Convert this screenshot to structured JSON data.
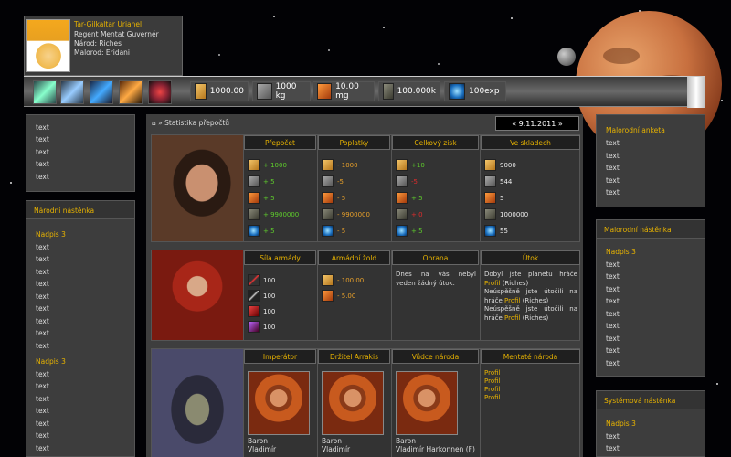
{
  "profile": {
    "name": "Tar-Gilkaltar Urianel",
    "rank": "Regent Mentat Guvernér",
    "nation": "Národ: Riches",
    "race": "Malorod: Eridani"
  },
  "resources": [
    {
      "icon": "gold-icon",
      "value": "1000.00"
    },
    {
      "icon": "metal-icon",
      "value": "1000 kg"
    },
    {
      "icon": "spice-icon",
      "value": "10.00 mg"
    },
    {
      "icon": "rock-icon",
      "value": "100.000k"
    },
    {
      "icon": "exp-icon",
      "value": "100exp"
    }
  ],
  "left": {
    "items_top": [
      "text",
      "text",
      "text",
      "text",
      "text"
    ],
    "section_title": "Národní nástěnka",
    "head1": "Nadpis 3",
    "items_mid": [
      "text",
      "text",
      "text",
      "text",
      "text",
      "text",
      "text",
      "text",
      "text",
      "text"
    ],
    "head2": "Nadpis 3",
    "items_bottom": [
      "text",
      "text",
      "text",
      "text",
      "text",
      "text",
      "text"
    ]
  },
  "main": {
    "breadcrumb": "⌂ » Statistika přepočtů",
    "date": "« 9.11.2011 »",
    "block1": {
      "headers": [
        "Přepočet",
        "Poplatky",
        "Celkový zisk",
        "Ve skladech"
      ],
      "prepocet": [
        "+ 1000",
        "+ 5",
        "+ 5",
        "+ 9900000",
        "+ 5"
      ],
      "poplatky": [
        "- 1000",
        "-5",
        "- 5",
        "- 9900000",
        "- 5"
      ],
      "zisk": [
        "+10",
        "-5",
        "+ 5",
        "+ 0",
        "+ 5"
      ],
      "sklady": [
        "9000",
        "544",
        "5",
        "1000000",
        "55"
      ]
    },
    "block2": {
      "headers": [
        "Síla armády",
        "Armádní žold",
        "Obrana",
        "Útok"
      ],
      "army": [
        "100",
        "100",
        "100",
        "100"
      ],
      "zold": [
        "- 100.00",
        "- 5.00"
      ],
      "obrana": "Dnes na vás nebyl veden žádný útok.",
      "utok1_a": "Dobyl jste planetu hráče",
      "utok1_b": "Profil",
      "utok1_c": "(Riches)",
      "utok2_a": "Neúspěšně jste útočili na hráče",
      "utok2_b": "Profil",
      "utok2_c": "(Riches)",
      "utok3_a": "Neúspěšně jste útočili na hráče",
      "utok3_b": "Profil",
      "utok3_c": "(Riches)"
    },
    "block3": {
      "headers": [
        "Imperátor",
        "Držitel Arrakis",
        "Vůdce národa",
        "Mentaté národa"
      ],
      "imperator": [
        "Baron",
        "Vladimír"
      ],
      "drzitel": [
        "Baron",
        "Vladimír"
      ],
      "vudce": [
        "Baron",
        "Vladimír Harkonnen (F)"
      ],
      "mentate": [
        "Profil",
        "Profil",
        "Profil",
        "Profil"
      ]
    }
  },
  "right": {
    "box1_title": "Malorodní anketa",
    "box1_items": [
      "text",
      "text",
      "text",
      "text",
      "text"
    ],
    "box2_title": "Malorodní nástěnka",
    "box2_head": "Nadpis 3",
    "box2_items": [
      "text",
      "text",
      "text",
      "text",
      "text",
      "text",
      "text",
      "text",
      "text"
    ],
    "box3_title": "Systémová nástěnka",
    "box3_head": "Nadpis 3",
    "box3_items": [
      "text",
      "text"
    ]
  },
  "colors": {
    "accent": "#e8b300",
    "positive": "#5ecb2c",
    "negative": "#e02c2c",
    "fee": "#e8a02a"
  }
}
